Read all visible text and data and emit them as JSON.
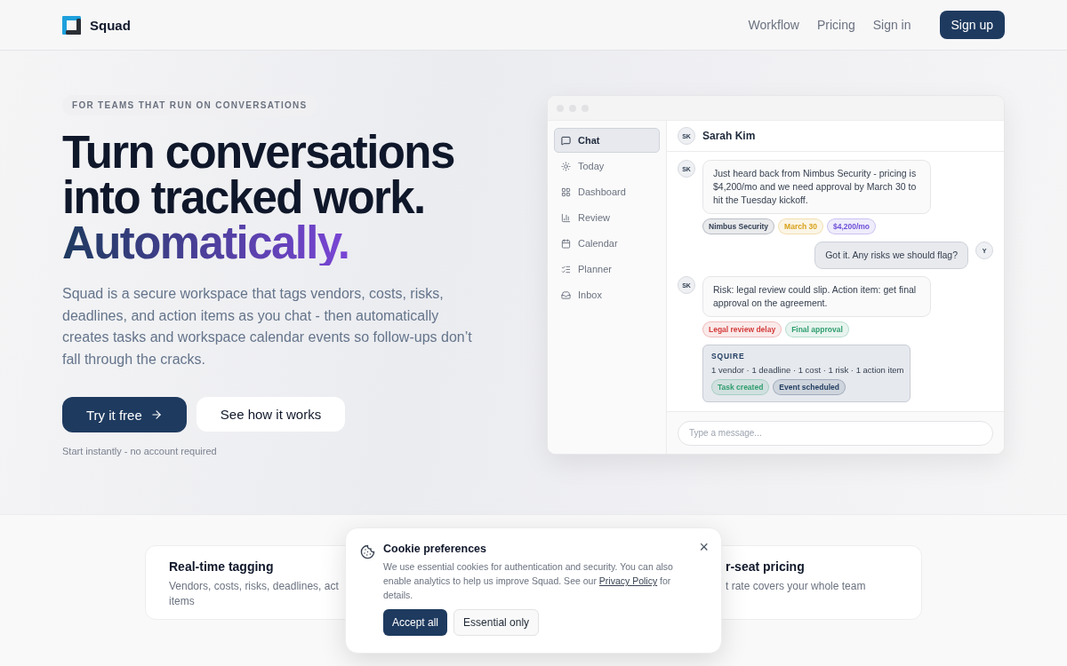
{
  "brand": {
    "name": "Squad"
  },
  "nav": {
    "links": [
      "Workflow",
      "Pricing",
      "Sign in"
    ],
    "cta": "Sign up"
  },
  "hero": {
    "eyebrow": "FOR TEAMS THAT RUN ON CONVERSATIONS",
    "headline": [
      {
        "text": "Turn conversations",
        "kind": "plain"
      },
      {
        "text": "into tracked work.",
        "kind": "plain"
      },
      {
        "text": "Automatically.",
        "kind": "gradient"
      }
    ],
    "description": "Squad is a secure workspace that tags vendors, costs, risks, deadlines, and action items as you chat - then automatically creates tasks and workspace calendar events so follow-ups don’t fall through the cracks.",
    "primary_button": "Try it free",
    "secondary_button": "See how it works",
    "note": "Start instantly - no account required"
  },
  "app": {
    "sidebar": [
      {
        "label": "Chat",
        "selected": true
      },
      {
        "label": "Today",
        "selected": false
      },
      {
        "label": "Dashboard",
        "selected": false
      },
      {
        "label": "Review",
        "selected": false
      },
      {
        "label": "Calendar",
        "selected": false
      },
      {
        "label": "Planner",
        "selected": false
      },
      {
        "label": "Inbox",
        "selected": false
      }
    ],
    "contact": {
      "initials": "SK",
      "name": "Sarah Kim"
    },
    "messages": [
      {
        "kind": "incoming",
        "initials": "SK",
        "text": "Just heard back from Nimbus Security - pricing is $4,200/mo and we need approval by March 30 to hit the Tuesday kickoff.",
        "tags": [
          {
            "label": "Nimbus Security",
            "color": "#334155"
          },
          {
            "label": "March 30",
            "color": "#d9a21b"
          },
          {
            "label": "$4,200/mo",
            "color": "#6d4fd8"
          }
        ]
      },
      {
        "kind": "outgoing",
        "initials": "Y",
        "text": "Got it. Any risks we should flag?"
      },
      {
        "kind": "incoming",
        "initials": "SK",
        "text": "Risk: legal review could slip. Action item: get final approval on the agreement.",
        "tags": [
          {
            "label": "Legal review delay",
            "color": "#d43c3c"
          },
          {
            "label": "Final approval",
            "color": "#2f9e6e"
          }
        ]
      },
      {
        "kind": "summary",
        "title": "SQUIRE",
        "text": "1 vendor · 1 deadline · 1 cost · 1 risk · 1 action item",
        "tags": [
          {
            "label": "Task created",
            "color": "#2f9e6e"
          },
          {
            "label": "Event scheduled",
            "color": "#1e3a5f"
          }
        ]
      }
    ],
    "composer": {
      "placeholder": "Type a message..."
    }
  },
  "features": [
    {
      "title": "Real-time tagging",
      "lines": [
        "Vendors, costs, risks, deadlines, act",
        "items"
      ]
    },
    {
      "title": "r-seat pricing",
      "lines": [
        "t rate covers your whole team"
      ]
    }
  ],
  "cookie": {
    "title": "Cookie preferences",
    "text_before": "We use essential cookies for authentication and security. You can also enable analytics to help us improve Squad. See our",
    "link": "Privacy Policy",
    "text_after": "for details.",
    "accept": "Accept all",
    "essential": "Essential only",
    "close": "×"
  }
}
